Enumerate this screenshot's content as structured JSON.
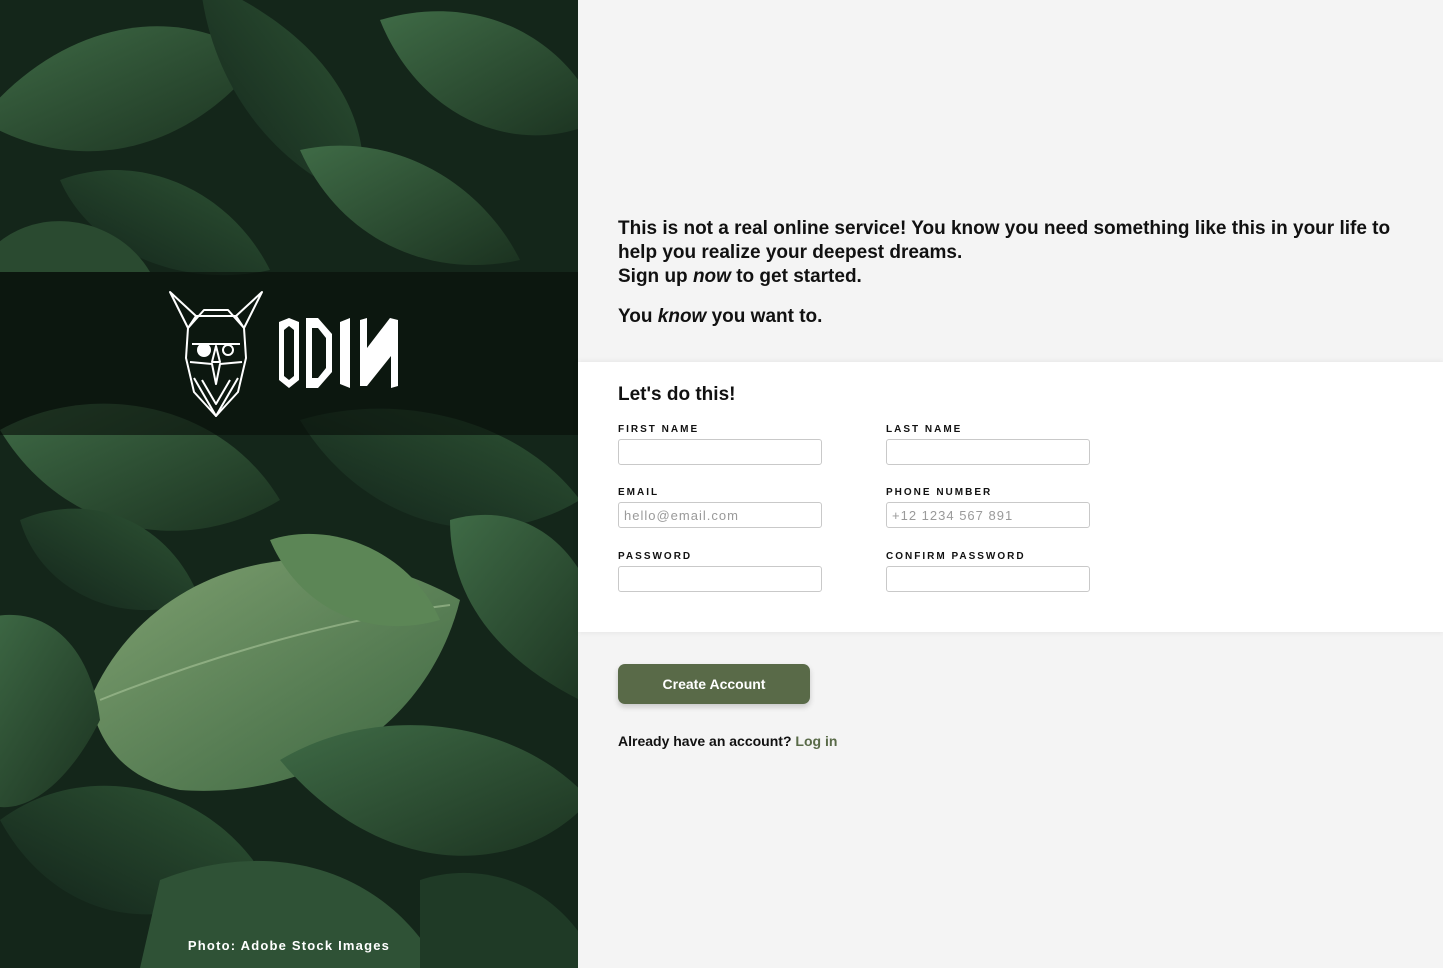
{
  "brand": {
    "logo_text": "ODIN"
  },
  "photo_credit": "Photo: Adobe Stock Images",
  "intro": {
    "line1": "This is not a real online service! You know you need something like this in your life to help you realize your deepest dreams.",
    "line2_before": "Sign up ",
    "line2_em": "now",
    "line2_after": " to get started.",
    "line3_before": "You ",
    "line3_em": "know",
    "line3_after": " you want to."
  },
  "form": {
    "heading": "Let's do this!",
    "fields": {
      "first_name": {
        "label": "FIRST NAME",
        "placeholder": "",
        "value": ""
      },
      "last_name": {
        "label": "LAST NAME",
        "placeholder": "",
        "value": ""
      },
      "email": {
        "label": "EMAIL",
        "placeholder": "hello@email.com",
        "value": ""
      },
      "phone": {
        "label": "PHONE NUMBER",
        "placeholder": "+12 1234 567 891",
        "value": ""
      },
      "password": {
        "label": "PASSWORD",
        "placeholder": "",
        "value": ""
      },
      "confirm_password": {
        "label": "CONFIRM PASSWORD",
        "placeholder": "",
        "value": ""
      }
    },
    "submit_label": "Create Account"
  },
  "login_prompt": {
    "text": "Already have an account? ",
    "link": "Log in"
  },
  "colors": {
    "accent": "#596a48",
    "page_bg": "#f4f4f4",
    "card_bg": "#ffffff"
  }
}
